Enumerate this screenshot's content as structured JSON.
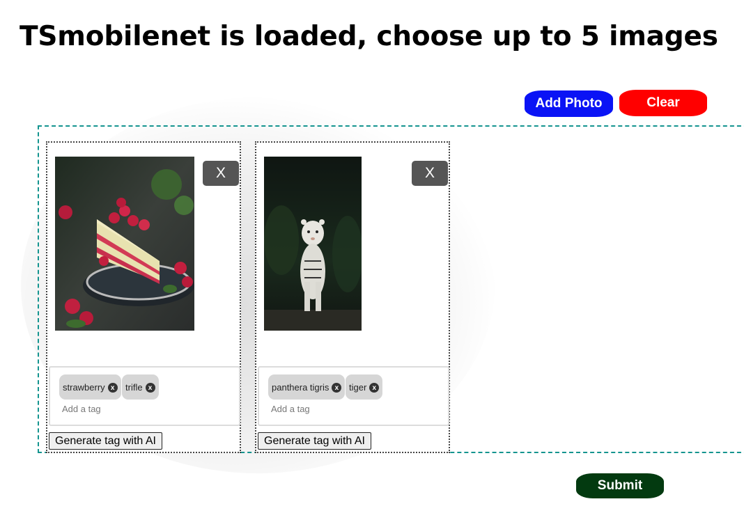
{
  "page": {
    "title": "TSmobilenet is loaded, choose up to 5 images"
  },
  "toolbar": {
    "add_photo": "Add Photo",
    "clear": "Clear"
  },
  "colors": {
    "add": "#0a13f5",
    "clear": "#ff0000",
    "submit": "#033a10",
    "dropzone_border": "#14948f"
  },
  "cards": [
    {
      "image": "strawberry-cake-photo",
      "remove_label": "X",
      "tags": [
        "strawberry",
        "trifle"
      ],
      "tag_placeholder": "Add a tag",
      "generate_label": "Generate tag with AI"
    },
    {
      "image": "white-tiger-photo",
      "remove_label": "X",
      "tags": [
        "panthera tigris",
        "tiger"
      ],
      "tag_placeholder": "Add a tag",
      "generate_label": "Generate tag with AI"
    }
  ],
  "tag_remove_glyph": "x",
  "submit": {
    "label": "Submit"
  }
}
